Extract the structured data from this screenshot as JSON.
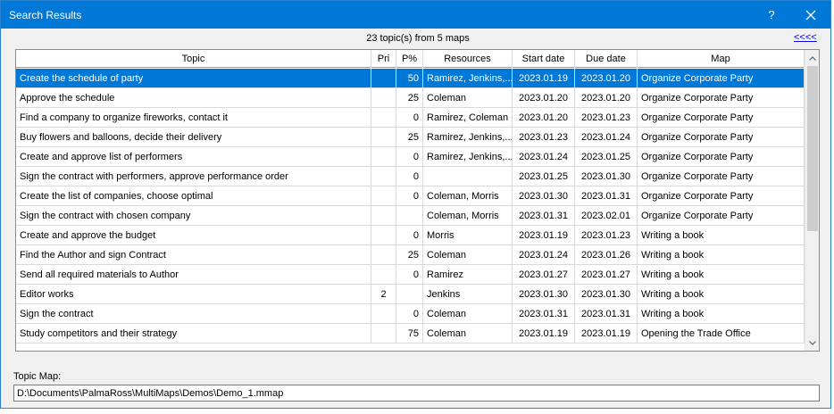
{
  "window": {
    "title": "Search Results",
    "help_label": "?",
    "icons": {
      "close": "close-icon",
      "scroll_up": "chevron-up-icon",
      "scroll_down": "chevron-down-icon"
    }
  },
  "summary": {
    "text": "23 topic(s) from 5 maps",
    "back_link": "<<<<"
  },
  "table": {
    "columns": [
      "Topic",
      "Pri",
      "P%",
      "Resources",
      "Start date",
      "Due date",
      "Map"
    ],
    "selected_row_index": 0,
    "rows": [
      [
        "Create the schedule of party",
        "",
        "50",
        "Ramirez, Jenkins,...",
        "2023.01.19",
        "2023.01.20",
        "Organize Corporate Party"
      ],
      [
        "Approve the schedule",
        "",
        "25",
        "Coleman",
        "2023.01.20",
        "2023.01.20",
        "Organize Corporate Party"
      ],
      [
        "Find a company to organize fireworks, contact it",
        "",
        "0",
        "Ramirez, Coleman",
        "2023.01.20",
        "2023.01.23",
        "Organize Corporate Party"
      ],
      [
        "Buy flowers and balloons, decide their delivery",
        "",
        "25",
        "Ramirez, Jenkins,...",
        "2023.01.23",
        "2023.01.24",
        "Organize Corporate Party"
      ],
      [
        "Create and approve list of performers",
        "",
        "0",
        "Ramirez, Jenkins,...",
        "2023.01.24",
        "2023.01.25",
        "Organize Corporate Party"
      ],
      [
        "Sign the contract with performers, approve performance order",
        "",
        "0",
        "",
        "2023.01.25",
        "2023.01.30",
        "Organize Corporate Party"
      ],
      [
        "Create the list of companies, choose optimal",
        "",
        "0",
        "Coleman, Morris",
        "2023.01.30",
        "2023.01.31",
        "Organize Corporate Party"
      ],
      [
        "Sign the contract with chosen company",
        "",
        "",
        "Coleman, Morris",
        "2023.01.31",
        "2023.02.01",
        "Organize Corporate Party"
      ],
      [
        "Create and approve the budget",
        "",
        "0",
        "Morris",
        "2023.01.19",
        "2023.01.23",
        "Writing a book"
      ],
      [
        "Find the Author and sign Contract",
        "",
        "25",
        "Coleman",
        "2023.01.24",
        "2023.01.26",
        "Writing a book"
      ],
      [
        "Send all required materials to Author",
        "",
        "0",
        "Ramirez",
        "2023.01.27",
        "2023.01.27",
        "Writing a book"
      ],
      [
        "Editor works",
        "2",
        "",
        "Jenkins",
        "2023.01.30",
        "2023.01.30",
        "Writing a book"
      ],
      [
        "Sign the contract",
        "",
        "0",
        "Coleman",
        "2023.01.31",
        "2023.01.31",
        "Writing a book"
      ],
      [
        "Study competitors and their strategy",
        "",
        "75",
        "Coleman",
        "2023.01.19",
        "2023.01.19",
        "Opening the Trade Office"
      ]
    ]
  },
  "topic_map": {
    "label": "Topic Map:",
    "value": "D:\\Documents\\PalmaRoss\\MultiMaps\\Demos\\Demo_1.mmap"
  }
}
